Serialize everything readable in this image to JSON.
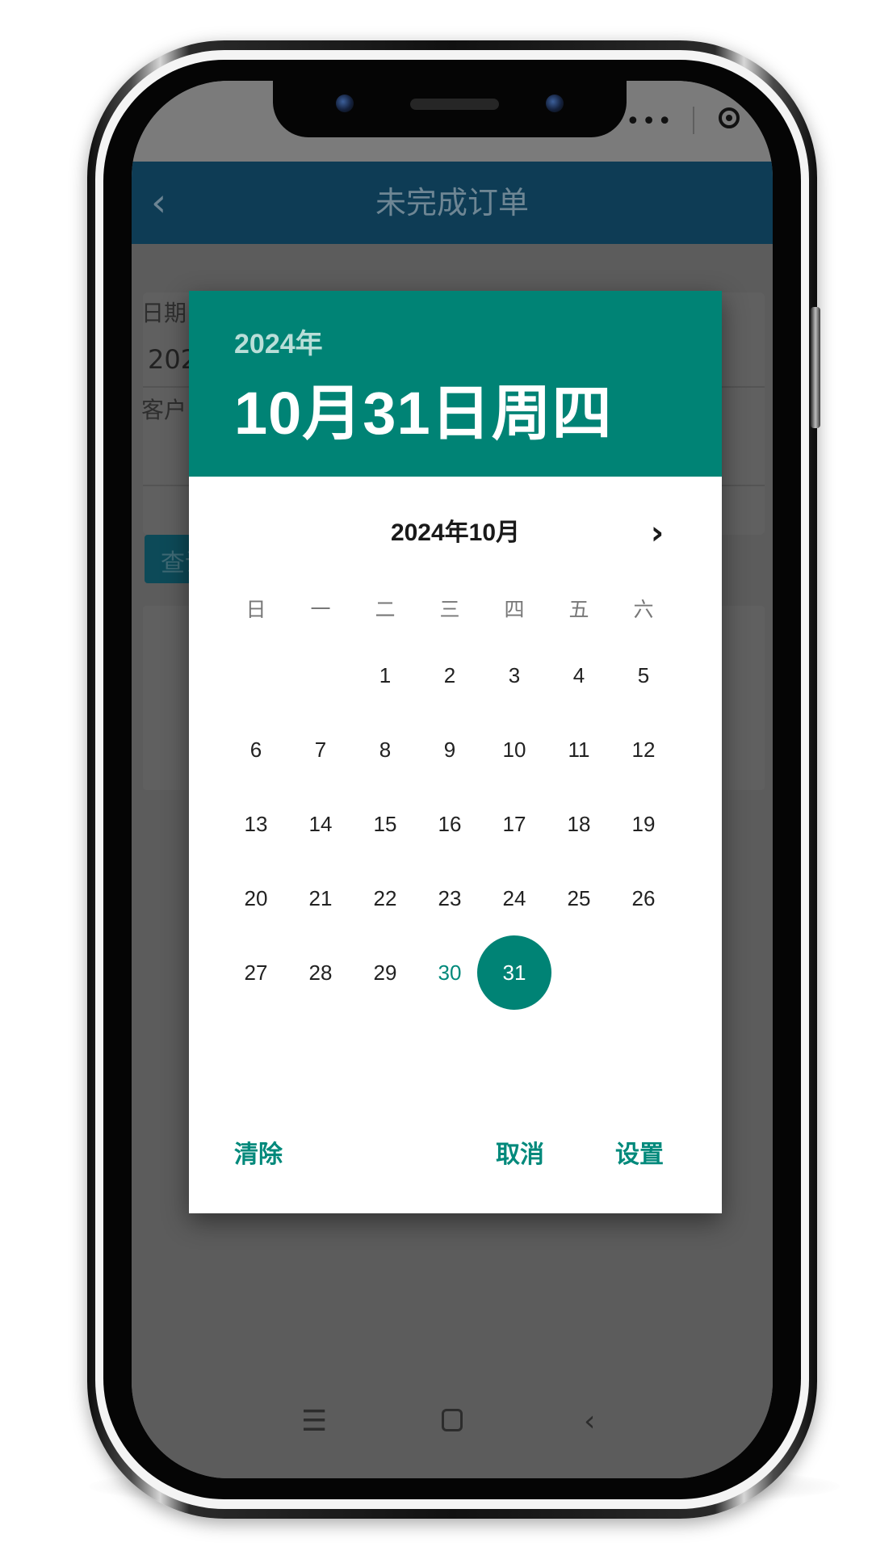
{
  "status_bar": {
    "capsule_more": "•••"
  },
  "app": {
    "title": "未完成订单",
    "back_icon": "chevron-left-icon",
    "form": {
      "date_label": "日期",
      "date_value": "2024-10-31",
      "customer_label": "客户"
    },
    "query_button": "查询"
  },
  "dialog": {
    "header_year": "2024年",
    "header_date": "10月31日周四",
    "month_label": "2024年10月",
    "weekdays": [
      "日",
      "一",
      "二",
      "三",
      "四",
      "五",
      "六"
    ],
    "weeks": [
      [
        "",
        "",
        "1",
        "2",
        "3",
        "4",
        "5"
      ],
      [
        "6",
        "7",
        "8",
        "9",
        "10",
        "11",
        "12"
      ],
      [
        "13",
        "14",
        "15",
        "16",
        "17",
        "18",
        "19"
      ],
      [
        "20",
        "21",
        "22",
        "23",
        "24",
        "25",
        "26"
      ],
      [
        "27",
        "28",
        "29",
        "30",
        "31",
        "",
        ""
      ]
    ],
    "today": "30",
    "selected": "31",
    "actions": {
      "clear": "清除",
      "cancel": "取消",
      "set": "设置"
    }
  },
  "colors": {
    "accent": "#008375",
    "header_bar": "#0e3c55",
    "overlay": "#5c5c5c"
  },
  "nav_icons": [
    "menu-icon",
    "home-icon",
    "back-icon"
  ]
}
